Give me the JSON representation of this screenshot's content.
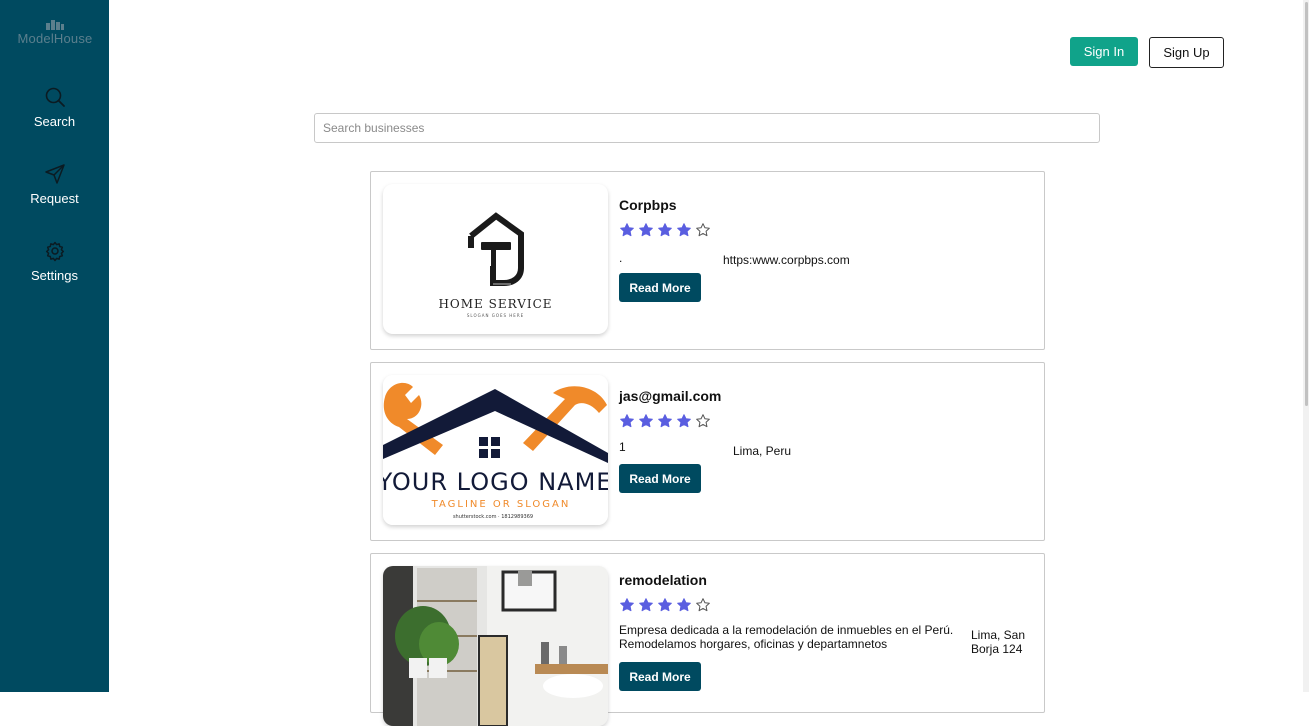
{
  "app": {
    "logo_text": "ModelHouse"
  },
  "sidebar": {
    "items": [
      {
        "label": "Search",
        "icon": "search-icon"
      },
      {
        "label": "Request",
        "icon": "send-icon"
      },
      {
        "label": "Settings",
        "icon": "gear-icon"
      }
    ]
  },
  "header": {
    "signin_label": "Sign In",
    "signup_label": "Sign Up"
  },
  "search": {
    "placeholder": "Search businesses",
    "value": ""
  },
  "businesses": [
    {
      "name": "Corpbps",
      "rating": 4,
      "max_rating": 5,
      "description": ".",
      "extra": "https:www.corpbps.com",
      "read_more": "Read More",
      "logo_text": "HOME SERVICE",
      "logo_sub": "SLOGAN GOES HERE"
    },
    {
      "name": "jas@gmail.com",
      "rating": 4,
      "max_rating": 5,
      "description": "1",
      "extra": "Lima, Peru",
      "read_more": "Read More",
      "logo_text": "YOUR LOGO NAME",
      "logo_sub": "TAGLINE OR SLOGAN",
      "logo_credit": "shutterstock.com · 1812989369"
    },
    {
      "name": "remodelation",
      "rating": 4,
      "max_rating": 5,
      "description": "Empresa dedicada a la remodelación de inmuebles en el Perú. Remodelamos horgares, oficinas y departamnetos",
      "extra": "Lima, San Borja 124",
      "read_more": "Read More"
    }
  ],
  "colors": {
    "sidebar": "#004a60",
    "accent_signin": "#10a38a",
    "read_more": "#004a60",
    "star": "#5a5ee0"
  }
}
